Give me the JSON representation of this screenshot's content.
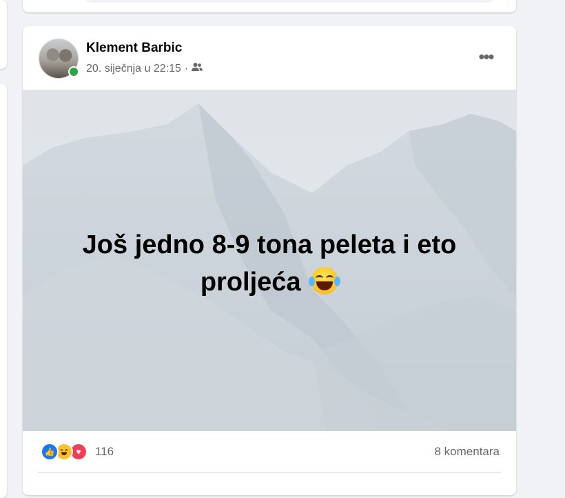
{
  "post": {
    "author": "Klement Barbic",
    "timestamp": "20. siječnja u 22:15",
    "separator": "·",
    "audience_icon": "friends-icon",
    "more_icon": "more-horizontal-icon",
    "text_line1": "Još jedno 8-9 tona peleta i eto",
    "text_line2": "proljeća",
    "emoji": "face-with-tears-of-joy",
    "background": "snowy-mountain",
    "online": true,
    "reactions": {
      "types": [
        "like",
        "haha",
        "love"
      ],
      "count": "116"
    },
    "comments": "8 komentara"
  },
  "colors": {
    "page_bg": "#f0f2f5",
    "card_bg": "#ffffff",
    "secondary_text": "#65676b",
    "online": "#31a24c",
    "like": "#1877f2",
    "love": "#f33e58",
    "haha": "#f7c327"
  }
}
